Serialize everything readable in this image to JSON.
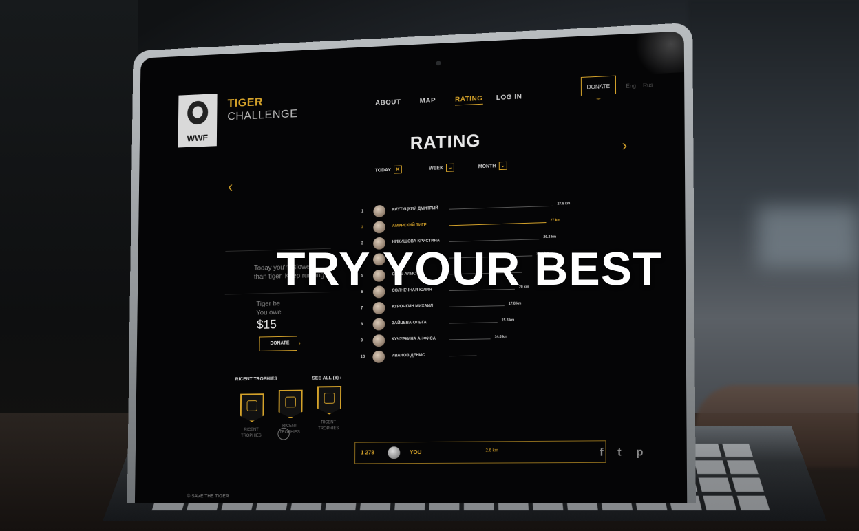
{
  "app": {
    "logo_text": "WWF",
    "brand_line1": "TIGER",
    "brand_line2": "CHALLENGE"
  },
  "nav": {
    "items": [
      "ABOUT",
      "MAP",
      "RATING",
      "LOG IN"
    ],
    "active": "RATING",
    "donate_label": "DONATE",
    "lang": [
      "Eng",
      "Rus"
    ]
  },
  "page": {
    "title": "RATING",
    "filters": [
      {
        "label": "TODAY",
        "mark": "✕"
      },
      {
        "label": "WEEK",
        "mark": "⌄"
      },
      {
        "label": "MONTH",
        "mark": "⌄"
      }
    ]
  },
  "status": {
    "message": "Today you're slower than tiger. Keep running.",
    "owe_line1": "Tiger be",
    "owe_line2": "You owe",
    "amount": "$15",
    "donate_label": "DONATE"
  },
  "trophies": {
    "heading": "RICENT TROPHIES",
    "see_all": "SEE ALL (8) ›",
    "items": [
      {
        "caption": "RICENT TROPHIES"
      },
      {
        "caption": "RICENT TROPHIES"
      },
      {
        "caption": "RICENT TROPHIES"
      }
    ]
  },
  "footer": {
    "copyright": "© SAVE THE TIGER"
  },
  "leaderboard": [
    {
      "rank": "1",
      "name": "КРУТИЦКИЙ ДМИТРИЙ",
      "km": "27.8 km",
      "highlight": false
    },
    {
      "rank": "2",
      "name": "АМУРСКИЙ ТИГР",
      "km": "27 km",
      "highlight": true
    },
    {
      "rank": "3",
      "name": "НИКИЩОВА КРИСТИНА",
      "km": "26.2 km",
      "highlight": false
    },
    {
      "rank": "4",
      "name": "",
      "km": "25.1 km",
      "highlight": false
    },
    {
      "rank": "5",
      "name": "СЕЛЕ АЛИС",
      "km": "",
      "highlight": false
    },
    {
      "rank": "6",
      "name": "СОЛНЕЧНАЯ ЮЛИЯ",
      "km": "20 km",
      "highlight": false
    },
    {
      "rank": "7",
      "name": "КУРОЧКИН МИХАИЛ",
      "km": "17.8 km",
      "highlight": false
    },
    {
      "rank": "8",
      "name": "ЗАЙЦЕВА ОЛЬГА",
      "km": "15.3 km",
      "highlight": false
    },
    {
      "rank": "9",
      "name": "КУЧУРКИНА АНФИСА",
      "km": "14.8 km",
      "highlight": false
    },
    {
      "rank": "10",
      "name": "ИВАНОВ ДЕНИС",
      "km": "",
      "highlight": false
    }
  ],
  "you_row": {
    "rank": "1 278",
    "name": "YOU",
    "km": "2.6 km"
  },
  "social": [
    "f",
    "t",
    "p"
  ],
  "headline": "TRY YOUR BEST"
}
